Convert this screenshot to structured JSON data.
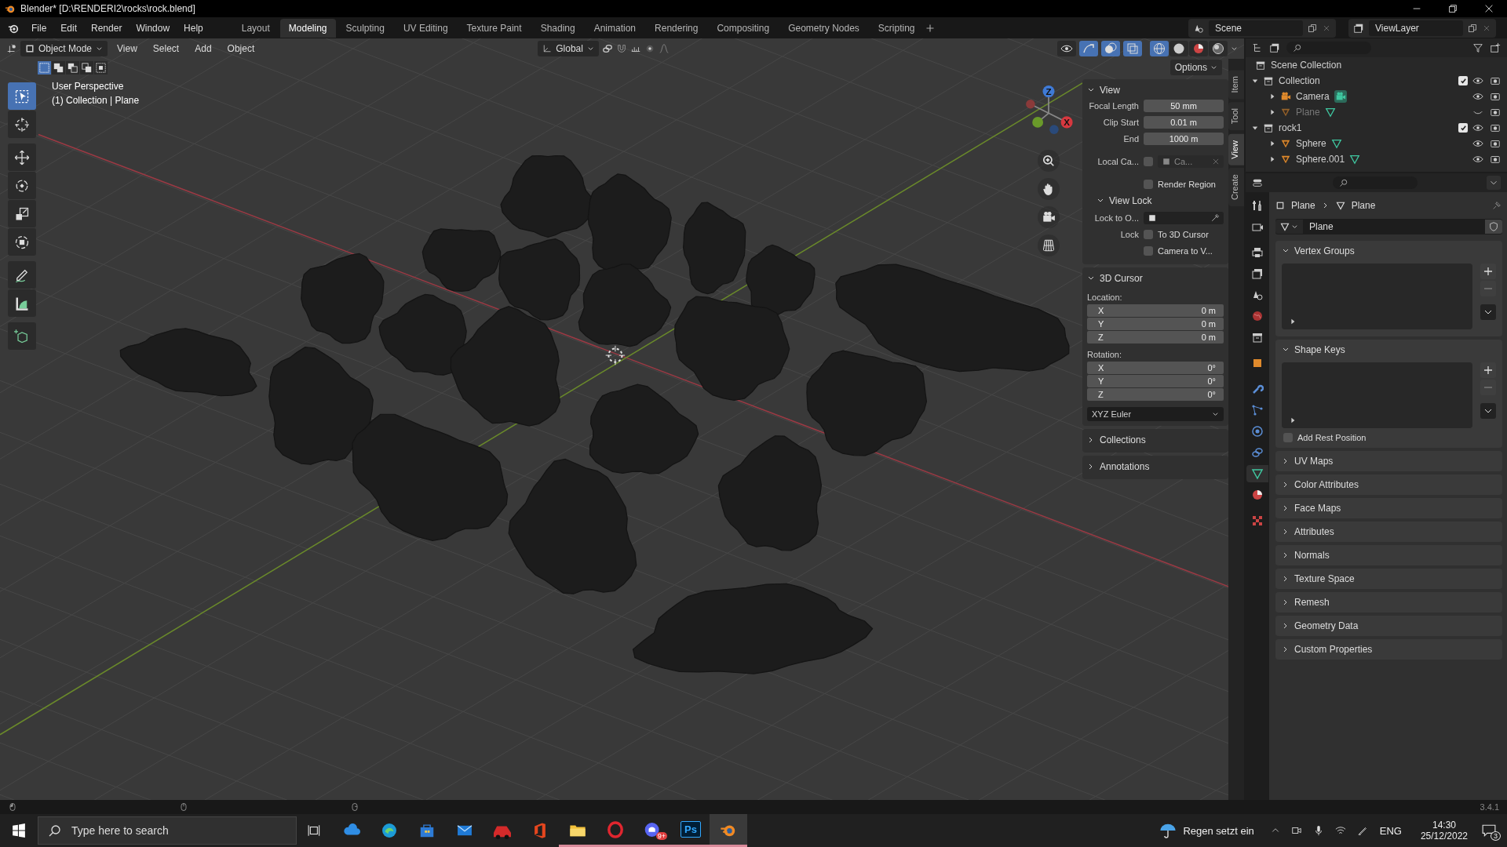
{
  "window": {
    "title": "Blender* [D:\\RENDERI2\\rocks\\rock.blend]"
  },
  "menu": [
    "File",
    "Edit",
    "Render",
    "Window",
    "Help"
  ],
  "workspaces": [
    {
      "label": "Layout",
      "selected": false
    },
    {
      "label": "Modeling",
      "selected": true
    },
    {
      "label": "Sculpting",
      "selected": false
    },
    {
      "label": "UV Editing",
      "selected": false
    },
    {
      "label": "Texture Paint",
      "selected": false
    },
    {
      "label": "Shading",
      "selected": false
    },
    {
      "label": "Animation",
      "selected": false
    },
    {
      "label": "Rendering",
      "selected": false
    },
    {
      "label": "Compositing",
      "selected": false
    },
    {
      "label": "Geometry Nodes",
      "selected": false
    },
    {
      "label": "Scripting",
      "selected": false
    }
  ],
  "scene": "Scene",
  "view_layer": "ViewLayer",
  "viewport_header": {
    "mode": "Object Mode",
    "menus": [
      "View",
      "Select",
      "Add",
      "Object"
    ],
    "orientation": "Global",
    "options": "Options",
    "toggles": [
      {
        "kind": "visibility",
        "on": false
      },
      {
        "kind": "gizmo",
        "on": true
      },
      {
        "kind": "overlay",
        "on": true
      },
      {
        "kind": "xray",
        "on": true
      }
    ],
    "shading_modes": [
      {
        "kind": "wireframe",
        "selected": true
      },
      {
        "kind": "solid",
        "selected": false
      },
      {
        "kind": "material",
        "selected": false
      },
      {
        "kind": "rendered",
        "selected": false
      }
    ]
  },
  "select_modes": [
    {
      "kind": "set",
      "selected": true
    },
    {
      "kind": "extend",
      "selected": false
    },
    {
      "kind": "subtract",
      "selected": false
    },
    {
      "kind": "invert",
      "selected": false
    },
    {
      "kind": "intersect",
      "selected": false
    }
  ],
  "tools": [
    {
      "kind": "select",
      "selected": true
    },
    {
      "kind": "cursor",
      "selected": false
    },
    {
      "kind": "move",
      "selected": false
    },
    {
      "kind": "rotate",
      "selected": false
    },
    {
      "kind": "scale",
      "selected": false
    },
    {
      "kind": "transform",
      "selected": false
    },
    {
      "kind": "annotate",
      "selected": false
    },
    {
      "kind": "measure",
      "selected": false
    },
    {
      "kind": "add-cube",
      "selected": false
    }
  ],
  "viewport_info": [
    "User Perspective",
    "(1) Collection | Plane"
  ],
  "gizmo_labels": [
    "Z",
    "X"
  ],
  "sidebar_tabs": [
    {
      "label": "Item",
      "selected": false
    },
    {
      "label": "Tool",
      "selected": false
    },
    {
      "label": "View",
      "selected": true
    },
    {
      "label": "Create",
      "selected": false
    }
  ],
  "view_panel": {
    "title": "View",
    "expanded": true,
    "fields": [
      {
        "label": "Focal Length",
        "value": "50 mm"
      },
      {
        "label": "Clip Start",
        "value": "0.01 m"
      },
      {
        "label": "End",
        "value": "1000 m"
      }
    ],
    "local_camera": {
      "label": "Local Ca...",
      "checked": false,
      "value": "Ca..."
    },
    "render_region": {
      "label": "Render Region",
      "checked": false
    },
    "view_lock": {
      "title": "View Lock",
      "expanded": true,
      "lock_to": "Lock to O...",
      "lock": "Lock",
      "options": [
        {
          "label": "To 3D Cursor",
          "checked": false
        },
        {
          "label": "Camera to V...",
          "checked": false
        }
      ]
    }
  },
  "cursor_panel": {
    "title": "3D Cursor",
    "expanded": true,
    "location_label": "Location:",
    "location": [
      {
        "axis": "X",
        "value": "0 m"
      },
      {
        "axis": "Y",
        "value": "0 m"
      },
      {
        "axis": "Z",
        "value": "0 m"
      }
    ],
    "rotation_label": "Rotation:",
    "rotation": [
      {
        "axis": "X",
        "value": "0°"
      },
      {
        "axis": "Y",
        "value": "0°"
      },
      {
        "axis": "Z",
        "value": "0°"
      }
    ],
    "rotation_mode": "XYZ Euler"
  },
  "sidebar_panels": [
    {
      "title": "Collections",
      "expanded": false
    },
    {
      "title": "Annotations",
      "expanded": false
    }
  ],
  "outliner": {
    "root": "Scene Collection",
    "children": [
      {
        "name": "Collection",
        "kind": "collection",
        "expanded": true,
        "checked": true,
        "visible": true,
        "children": [
          {
            "name": "Camera",
            "kind": "camera",
            "expanded": false,
            "visible": true
          },
          {
            "name": "Plane",
            "kind": "mesh",
            "expanded": false,
            "visible": false
          }
        ]
      },
      {
        "name": "rock1",
        "kind": "collection",
        "expanded": true,
        "checked": true,
        "visible": true,
        "children": [
          {
            "name": "Sphere",
            "kind": "mesh",
            "expanded": false,
            "visible": true
          },
          {
            "name": "Sphere.001",
            "kind": "mesh",
            "expanded": false,
            "visible": true
          }
        ]
      }
    ]
  },
  "property_tabs": [
    {
      "kind": "tools",
      "selected": false
    },
    {
      "kind": "render",
      "selected": false
    },
    {
      "kind": "output",
      "selected": false
    },
    {
      "kind": "view-layer",
      "selected": false
    },
    {
      "kind": "scene",
      "selected": false
    },
    {
      "kind": "world",
      "selected": false
    },
    {
      "kind": "collection",
      "selected": false
    },
    {
      "kind": "object",
      "selected": false
    },
    {
      "kind": "modifier",
      "selected": false
    },
    {
      "kind": "particles",
      "selected": false
    },
    {
      "kind": "physics",
      "selected": false
    },
    {
      "kind": "constraints",
      "selected": false
    },
    {
      "kind": "data",
      "selected": true
    },
    {
      "kind": "material",
      "selected": false
    },
    {
      "kind": "texture",
      "selected": false
    }
  ],
  "properties": {
    "breadcrumb": [
      "Plane",
      "Plane"
    ],
    "mesh_name": "Plane",
    "panels": [
      {
        "title": "Vertex Groups",
        "kind": "list",
        "expanded": true
      },
      {
        "title": "Shape Keys",
        "kind": "list",
        "expanded": true,
        "option": {
          "label": "Add Rest Position",
          "checked": false
        }
      },
      {
        "title": "UV Maps",
        "kind": "header",
        "expanded": false
      },
      {
        "title": "Color Attributes",
        "kind": "header",
        "expanded": false
      },
      {
        "title": "Face Maps",
        "kind": "header",
        "expanded": false
      },
      {
        "title": "Attributes",
        "kind": "header",
        "expanded": false
      },
      {
        "title": "Normals",
        "kind": "header",
        "expanded": false
      },
      {
        "title": "Texture Space",
        "kind": "header",
        "expanded": false
      },
      {
        "title": "Remesh",
        "kind": "header",
        "expanded": false
      },
      {
        "title": "Geometry Data",
        "kind": "header",
        "expanded": false
      },
      {
        "title": "Custom Properties",
        "kind": "header",
        "expanded": false
      }
    ]
  },
  "status_bar": {
    "version": "3.4.1"
  },
  "taskbar": {
    "search_placeholder": "Type here to search",
    "apps": [
      {
        "kind": "cloud",
        "running": false,
        "selected": false
      },
      {
        "kind": "browser",
        "running": false,
        "selected": false
      },
      {
        "kind": "store",
        "running": false,
        "selected": false
      },
      {
        "kind": "mail",
        "running": false,
        "selected": false
      },
      {
        "kind": "car",
        "running": false,
        "selected": false
      },
      {
        "kind": "office",
        "running": false,
        "selected": false
      },
      {
        "kind": "folder",
        "running": true,
        "selected": false
      },
      {
        "kind": "ring",
        "running": true,
        "selected": false
      },
      {
        "kind": "chat",
        "running": true,
        "selected": false,
        "badge": "9+"
      },
      {
        "kind": "photoshop",
        "running": true,
        "selected": false,
        "label": "Ps"
      },
      {
        "kind": "blender",
        "running": true,
        "selected": true
      }
    ],
    "weather": "Regen setzt ein",
    "language": "ENG",
    "time": "14:30",
    "date": "25/12/2022",
    "notifications": "3"
  }
}
